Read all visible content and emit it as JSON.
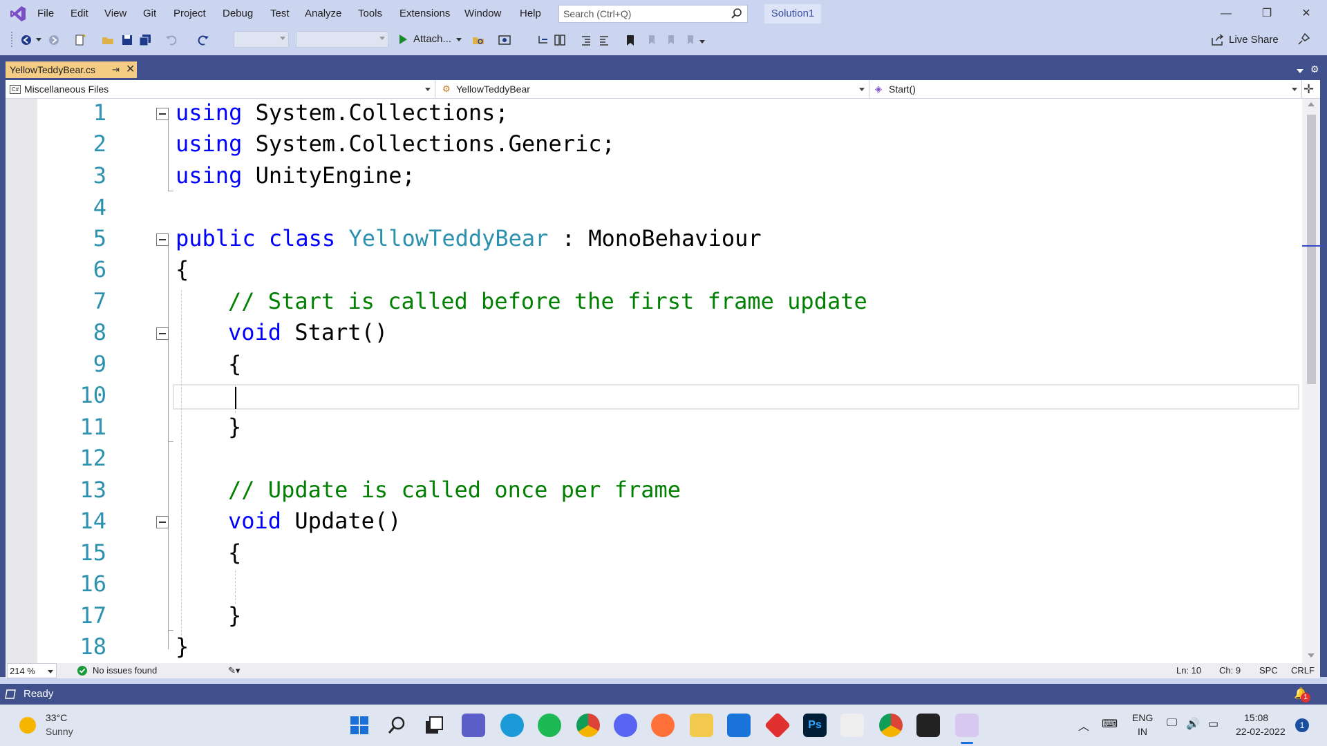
{
  "window": {
    "menu": [
      "File",
      "Edit",
      "View",
      "Git",
      "Project",
      "Debug",
      "Test",
      "Analyze",
      "Tools",
      "Extensions",
      "Window",
      "Help"
    ],
    "search_placeholder": "Search (Ctrl+Q)",
    "solution": "Solution1"
  },
  "toolbar": {
    "attach_label": "Attach...",
    "live_share_label": "Live Share"
  },
  "document": {
    "tab_name": "YellowTeddyBear.cs",
    "nav_project": "Miscellaneous Files",
    "nav_class": "YellowTeddyBear",
    "nav_member": "Start()"
  },
  "code": {
    "line_numbers": [
      "1",
      "2",
      "3",
      "4",
      "5",
      "6",
      "7",
      "8",
      "9",
      "10",
      "11",
      "12",
      "13",
      "14",
      "15",
      "16",
      "17",
      "18"
    ],
    "using1_kw": "using",
    "using1_ns": " System.Collections;",
    "using2_kw": "using",
    "using2_ns": " System.Collections.Generic;",
    "using3_kw": "using",
    "using3_ns": " UnityEngine;",
    "class_public": "public",
    "class_kw": "class",
    "class_name": "YellowTeddyBear",
    "class_base": " : MonoBehaviour",
    "open_brace": "{",
    "comment_start": "// Start is called before the first frame update",
    "start_void": "void",
    "start_sig": " Start()",
    "start_open": "{",
    "start_close": "}",
    "comment_update": "// Update is called once per frame",
    "update_void": "void",
    "update_sig": " Update()",
    "update_open": "{",
    "update_close": "}",
    "close_brace": "}"
  },
  "editor_status": {
    "zoom": "214 %",
    "issues": "No issues found",
    "line": "Ln: 10",
    "char": "Ch: 9",
    "spacing": "SPC",
    "line_ending": "CRLF"
  },
  "status_bar": {
    "state": "Ready",
    "notifications": "1"
  },
  "taskbar": {
    "weather_temp": "33°C",
    "weather_desc": "Sunny",
    "lang_1": "ENG",
    "lang_2": "IN",
    "time": "15:08",
    "date": "22-02-2022",
    "notif_count": "1"
  }
}
